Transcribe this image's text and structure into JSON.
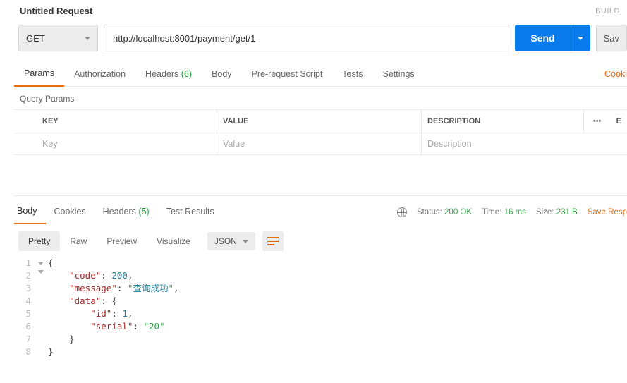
{
  "titlebar": {
    "title": "Untitled Request",
    "build": "BUILD"
  },
  "request": {
    "method": "GET",
    "url": "http://localhost:8001/payment/get/1",
    "send": "Send",
    "save": "Sav"
  },
  "reqTabs": {
    "params": "Params",
    "authorization": "Authorization",
    "headers": "Headers",
    "headersCount": "(6)",
    "body": "Body",
    "prerequest": "Pre-request Script",
    "tests": "Tests",
    "settings": "Settings",
    "cookies": "Cooki"
  },
  "qp": {
    "label": "Query Params",
    "keyHdr": "KEY",
    "valueHdr": "VALUE",
    "descHdr": "DESCRIPTION",
    "more": "•••",
    "bulk": "E",
    "keyPh": "Key",
    "valuePh": "Value",
    "descPh": "Description"
  },
  "respTabs": {
    "body": "Body",
    "cookies": "Cookies",
    "headers": "Headers",
    "headersCount": "(5)",
    "testResults": "Test Results"
  },
  "status": {
    "statusLabel": "Status:",
    "statusVal": "200 OK",
    "timeLabel": "Time:",
    "timeVal": "16 ms",
    "sizeLabel": "Size:",
    "sizeVal": "231 B",
    "saveResp": "Save Resp"
  },
  "viewRow": {
    "pretty": "Pretty",
    "raw": "Raw",
    "preview": "Preview",
    "visualize": "Visualize",
    "format": "JSON"
  },
  "code": {
    "l1": "{",
    "l2a": "    ",
    "l2k": "\"code\"",
    "l2c": ": ",
    "l2v": "200",
    "l2p": ",",
    "l3a": "    ",
    "l3k": "\"message\"",
    "l3c": ": ",
    "l3q1": "\"",
    "l3v": "查询成功",
    "l3q2": "\"",
    "l3p": ",",
    "l4a": "    ",
    "l4k": "\"data\"",
    "l4c": ": {",
    "l5a": "        ",
    "l5k": "\"id\"",
    "l5c": ": ",
    "l5v": "1",
    "l5p": ",",
    "l6a": "        ",
    "l6k": "\"serial\"",
    "l6c": ": ",
    "l6v": "\"20\"",
    "l7": "    }",
    "l8": "}"
  }
}
